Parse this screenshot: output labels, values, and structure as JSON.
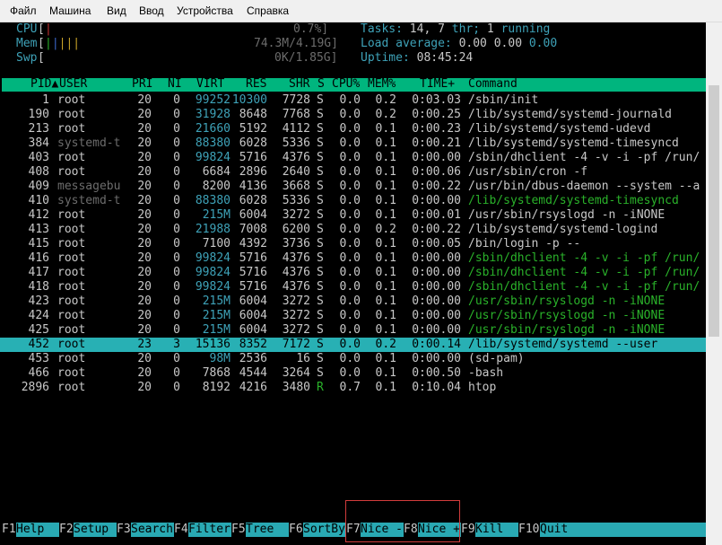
{
  "menu": [
    "Файл",
    "Машина",
    "Вид",
    "Ввод",
    "Устройства",
    "Справка"
  ],
  "meters": {
    "cpu_label": "CPU",
    "cpu_value": "0.7%]",
    "mem_label": "Mem",
    "mem_value": "74.3M/4.19G]",
    "swp_label": "Swp",
    "swp_value": "0K/1.85G]"
  },
  "summary": {
    "tasks_label": "Tasks:",
    "tasks_value": "14,",
    "threads_value": "7",
    "threads_label": "thr;",
    "running_value": "1",
    "running_label": "running",
    "load_label": "Load average:",
    "load1": "0.00",
    "load5": "0.00",
    "load15": "0.00",
    "uptime_label": "Uptime:",
    "uptime_value": "08:45:24"
  },
  "columns": {
    "pid": "PID",
    "user": "USER",
    "pri": "PRI",
    "ni": "NI",
    "virt": "VIRT",
    "res": "RES",
    "shr": "SHR",
    "s": "S",
    "cpu": "CPU%",
    "mem": "MEM%",
    "time": "TIME+",
    "command": "Command"
  },
  "processes": [
    {
      "pid": "1",
      "user": "root",
      "pri": "20",
      "ni": "0",
      "virt": "99252",
      "res": "10300",
      "shr": "7728",
      "s": "S",
      "cpu": "0.0",
      "mem": "0.2",
      "time": "0:03.03",
      "command": "/sbin/init"
    },
    {
      "pid": "190",
      "user": "root",
      "pri": "20",
      "ni": "0",
      "virt": "31928",
      "res": "8648",
      "shr": "7768",
      "s": "S",
      "cpu": "0.0",
      "mem": "0.2",
      "time": "0:00.25",
      "command": "/lib/systemd/systemd-journald"
    },
    {
      "pid": "213",
      "user": "root",
      "pri": "20",
      "ni": "0",
      "virt": "21660",
      "res": "5192",
      "shr": "4112",
      "s": "S",
      "cpu": "0.0",
      "mem": "0.1",
      "time": "0:00.23",
      "command": "/lib/systemd/systemd-udevd"
    },
    {
      "pid": "384",
      "user": "systemd-t",
      "pri": "20",
      "ni": "0",
      "virt": "88380",
      "res": "6028",
      "shr": "5336",
      "s": "S",
      "cpu": "0.0",
      "mem": "0.1",
      "time": "0:00.21",
      "command": "/lib/systemd/systemd-timesyncd"
    },
    {
      "pid": "403",
      "user": "root",
      "pri": "20",
      "ni": "0",
      "virt": "99824",
      "res": "5716",
      "shr": "4376",
      "s": "S",
      "cpu": "0.0",
      "mem": "0.1",
      "time": "0:00.00",
      "command": "/sbin/dhclient -4 -v -i -pf /run/"
    },
    {
      "pid": "408",
      "user": "root",
      "pri": "20",
      "ni": "0",
      "virt": "6684",
      "res": "2896",
      "shr": "2640",
      "s": "S",
      "cpu": "0.0",
      "mem": "0.1",
      "time": "0:00.06",
      "command": "/usr/sbin/cron -f"
    },
    {
      "pid": "409",
      "user": "messagebu",
      "pri": "20",
      "ni": "0",
      "virt": "8200",
      "res": "4136",
      "shr": "3668",
      "s": "S",
      "cpu": "0.0",
      "mem": "0.1",
      "time": "0:00.22",
      "command": "/usr/bin/dbus-daemon --system --a"
    },
    {
      "pid": "410",
      "user": "systemd-t",
      "pri": "20",
      "ni": "0",
      "virt": "88380",
      "res": "6028",
      "shr": "5336",
      "s": "S",
      "cpu": "0.0",
      "mem": "0.1",
      "time": "0:00.00",
      "command": "/lib/systemd/systemd-timesyncd"
    },
    {
      "pid": "412",
      "user": "root",
      "pri": "20",
      "ni": "0",
      "virt": "215M",
      "res": "6004",
      "shr": "3272",
      "s": "S",
      "cpu": "0.0",
      "mem": "0.1",
      "time": "0:00.01",
      "command": "/usr/sbin/rsyslogd -n -iNONE"
    },
    {
      "pid": "413",
      "user": "root",
      "pri": "20",
      "ni": "0",
      "virt": "21988",
      "res": "7008",
      "shr": "6200",
      "s": "S",
      "cpu": "0.0",
      "mem": "0.2",
      "time": "0:00.22",
      "command": "/lib/systemd/systemd-logind"
    },
    {
      "pid": "415",
      "user": "root",
      "pri": "20",
      "ni": "0",
      "virt": "7100",
      "res": "4392",
      "shr": "3736",
      "s": "S",
      "cpu": "0.0",
      "mem": "0.1",
      "time": "0:00.05",
      "command": "/bin/login -p --"
    },
    {
      "pid": "416",
      "user": "root",
      "pri": "20",
      "ni": "0",
      "virt": "99824",
      "res": "5716",
      "shr": "4376",
      "s": "S",
      "cpu": "0.0",
      "mem": "0.1",
      "time": "0:00.00",
      "command": "/sbin/dhclient -4 -v -i -pf /run/"
    },
    {
      "pid": "417",
      "user": "root",
      "pri": "20",
      "ni": "0",
      "virt": "99824",
      "res": "5716",
      "shr": "4376",
      "s": "S",
      "cpu": "0.0",
      "mem": "0.1",
      "time": "0:00.00",
      "command": "/sbin/dhclient -4 -v -i -pf /run/"
    },
    {
      "pid": "418",
      "user": "root",
      "pri": "20",
      "ni": "0",
      "virt": "99824",
      "res": "5716",
      "shr": "4376",
      "s": "S",
      "cpu": "0.0",
      "mem": "0.1",
      "time": "0:00.00",
      "command": "/sbin/dhclient -4 -v -i -pf /run/"
    },
    {
      "pid": "423",
      "user": "root",
      "pri": "20",
      "ni": "0",
      "virt": "215M",
      "res": "6004",
      "shr": "3272",
      "s": "S",
      "cpu": "0.0",
      "mem": "0.1",
      "time": "0:00.00",
      "command": "/usr/sbin/rsyslogd -n -iNONE"
    },
    {
      "pid": "424",
      "user": "root",
      "pri": "20",
      "ni": "0",
      "virt": "215M",
      "res": "6004",
      "shr": "3272",
      "s": "S",
      "cpu": "0.0",
      "mem": "0.1",
      "time": "0:00.00",
      "command": "/usr/sbin/rsyslogd -n -iNONE"
    },
    {
      "pid": "425",
      "user": "root",
      "pri": "20",
      "ni": "0",
      "virt": "215M",
      "res": "6004",
      "shr": "3272",
      "s": "S",
      "cpu": "0.0",
      "mem": "0.1",
      "time": "0:00.00",
      "command": "/usr/sbin/rsyslogd -n -iNONE"
    },
    {
      "pid": "452",
      "user": "root",
      "pri": "23",
      "ni": "3",
      "virt": "15136",
      "res": "8352",
      "shr": "7172",
      "s": "S",
      "cpu": "0.0",
      "mem": "0.2",
      "time": "0:00.14",
      "command": "/lib/systemd/systemd --user"
    },
    {
      "pid": "453",
      "user": "root",
      "pri": "20",
      "ni": "0",
      "virt": "98M",
      "res": "2536",
      "shr": "16",
      "s": "S",
      "cpu": "0.0",
      "mem": "0.1",
      "time": "0:00.00",
      "command": "(sd-pam)"
    },
    {
      "pid": "466",
      "user": "root",
      "pri": "20",
      "ni": "0",
      "virt": "7868",
      "res": "4544",
      "shr": "3264",
      "s": "S",
      "cpu": "0.0",
      "mem": "0.1",
      "time": "0:00.50",
      "command": "-bash"
    },
    {
      "pid": "2896",
      "user": "root",
      "pri": "20",
      "ni": "0",
      "virt": "8192",
      "res": "4216",
      "shr": "3480",
      "s": "R",
      "cpu": "0.7",
      "mem": "0.1",
      "time": "0:10.04",
      "command": "htop"
    }
  ],
  "fkeys": [
    {
      "num": "F1",
      "label": "Help"
    },
    {
      "num": "F2",
      "label": "Setup"
    },
    {
      "num": "F3",
      "label": "Search"
    },
    {
      "num": "F4",
      "label": "Filter"
    },
    {
      "num": "F5",
      "label": "Tree"
    },
    {
      "num": "F6",
      "label": "SortBy"
    },
    {
      "num": "F7",
      "label": "Nice -"
    },
    {
      "num": "F8",
      "label": "Nice +"
    },
    {
      "num": "F9",
      "label": "Kill"
    },
    {
      "num": "F10",
      "label": "Quit"
    }
  ]
}
